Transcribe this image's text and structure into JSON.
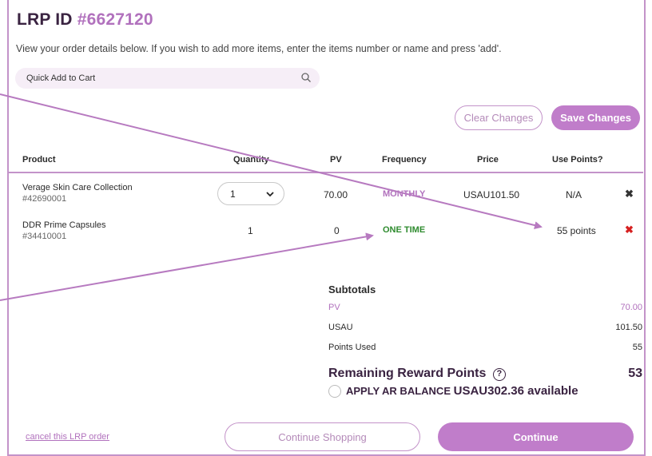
{
  "header": {
    "title_prefix": "LRP ID",
    "title_id": "#6627120",
    "intro": "View your order details below. If you wish to add more items, enter the items number or name and press 'add'."
  },
  "search": {
    "placeholder": "Quick Add to Cart",
    "icon": "search-icon"
  },
  "actions": {
    "clear_label": "Clear Changes",
    "save_label": "Save Changes"
  },
  "table": {
    "headers": [
      "Product",
      "Quantity",
      "PV",
      "Frequency",
      "Price",
      "Use Points?"
    ],
    "rows": [
      {
        "product": "Verage Skin Care Collection",
        "sku": "#42690001",
        "quantity": "1",
        "pv": "70.00",
        "frequency": "MONTHLY",
        "price": "USAU101.50",
        "use_points": "N/A",
        "remove_icon": "close-icon"
      },
      {
        "product": "DDR Prime Capsules",
        "sku": "#34410001",
        "quantity": "1",
        "pv": "0",
        "frequency": "ONE TIME",
        "price": "",
        "use_points": "55 points",
        "remove_icon": "close-icon"
      }
    ]
  },
  "subtotals": {
    "heading": "Subtotals",
    "pv_label": "PV",
    "pv_value": "70.00",
    "usau_label": "USAU",
    "usau_value": "101.50",
    "points_label": "Points Used",
    "points_value": "55"
  },
  "rewards": {
    "remaining_label": "Remaining Reward Points",
    "remaining_value": "53",
    "help_symbol": "?",
    "apply_label": "APPLY AR BALANCE",
    "available": "USAU302.36 available"
  },
  "footer": {
    "cancel_label": "cancel this LRP order",
    "continue_shopping_label": "Continue Shopping",
    "continue_label": "Continue"
  },
  "colors": {
    "accent": "#c07dca",
    "accent_light": "#c393c9",
    "green": "#2e8b2e",
    "remove_red": "#d62020"
  }
}
